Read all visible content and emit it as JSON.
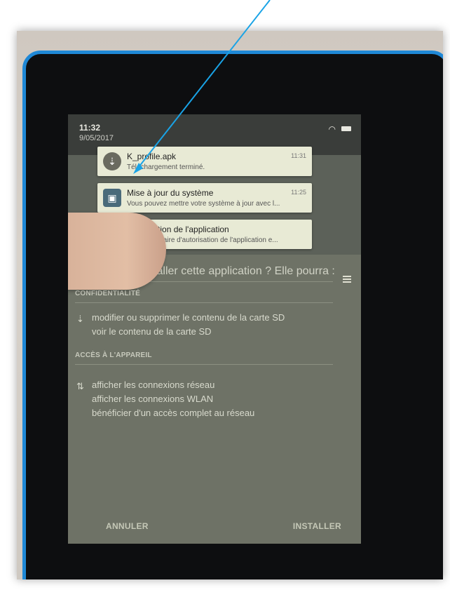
{
  "status": {
    "time": "11:32",
    "date": "9/05/2017",
    "wifi": "wifi-icon",
    "battery": "battery-icon"
  },
  "notifications": [
    {
      "title": "K_profile.apk",
      "subtitle": "Téléchargement terminé.",
      "time": "11:31",
      "icon": "download-icon"
    },
    {
      "title": "Mise à jour du système",
      "subtitle": "Vous pouvez mettre votre système à jour avec l...",
      "time": "11:25",
      "icon": "system-update-icon"
    },
    {
      "title": "Autorisation de l'application",
      "subtitle": "Le gestionnaire d'autorisation de l'application e...",
      "time": "",
      "icon": "lock-icon"
    }
  ],
  "dialog": {
    "question": "Voulez-vous installer cette application ? Elle pourra :",
    "sections": [
      {
        "title": "CONFIDENTIALITÉ",
        "items": [
          "modifier ou supprimer le contenu de la carte SD",
          "voir le contenu de la carte SD"
        ]
      },
      {
        "title": "ACCÈS À L'APPAREIL",
        "items": [
          "afficher les connexions réseau",
          "afficher les connexions WLAN",
          "bénéficier d'un accès complet au réseau"
        ]
      }
    ],
    "cancel_label": "ANNULER",
    "install_label": "INSTALLER"
  }
}
